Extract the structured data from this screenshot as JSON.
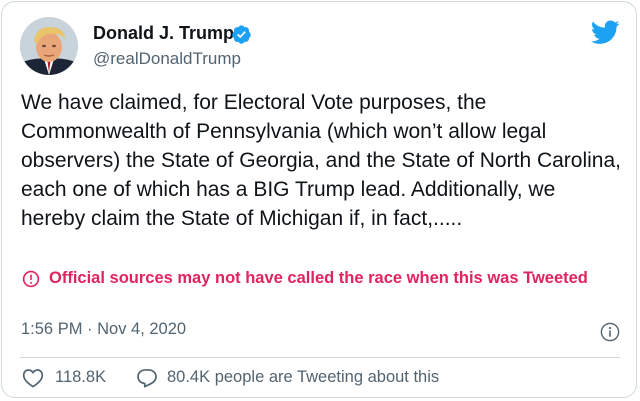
{
  "author": {
    "display_name": "Donald J. Trump",
    "handle": "@realDonaldTrump",
    "verified": true,
    "avatar_icon": "profile-photo"
  },
  "brand_icon": "twitter-bird-icon",
  "tweet": {
    "text": "We have claimed, for Electoral Vote purposes, the Commonwealth of Pennsylvania (which won’t allow legal observers) the State of Georgia, and the State of North Carolina, each one of which has a BIG Trump lead. Additionally, we hereby claim the State of Michigan if, in fact,.....",
    "notice": "Official sources may not have called the race when this was Tweeted",
    "timestamp": "1:56 PM · Nov 4, 2020"
  },
  "actions": {
    "likes": "118.8K",
    "reply_text": "80.4K people are Tweeting about this"
  },
  "colors": {
    "accent": "#1da1f2",
    "notice": "#e0245e",
    "muted": "#536471",
    "text": "#0f1419"
  }
}
